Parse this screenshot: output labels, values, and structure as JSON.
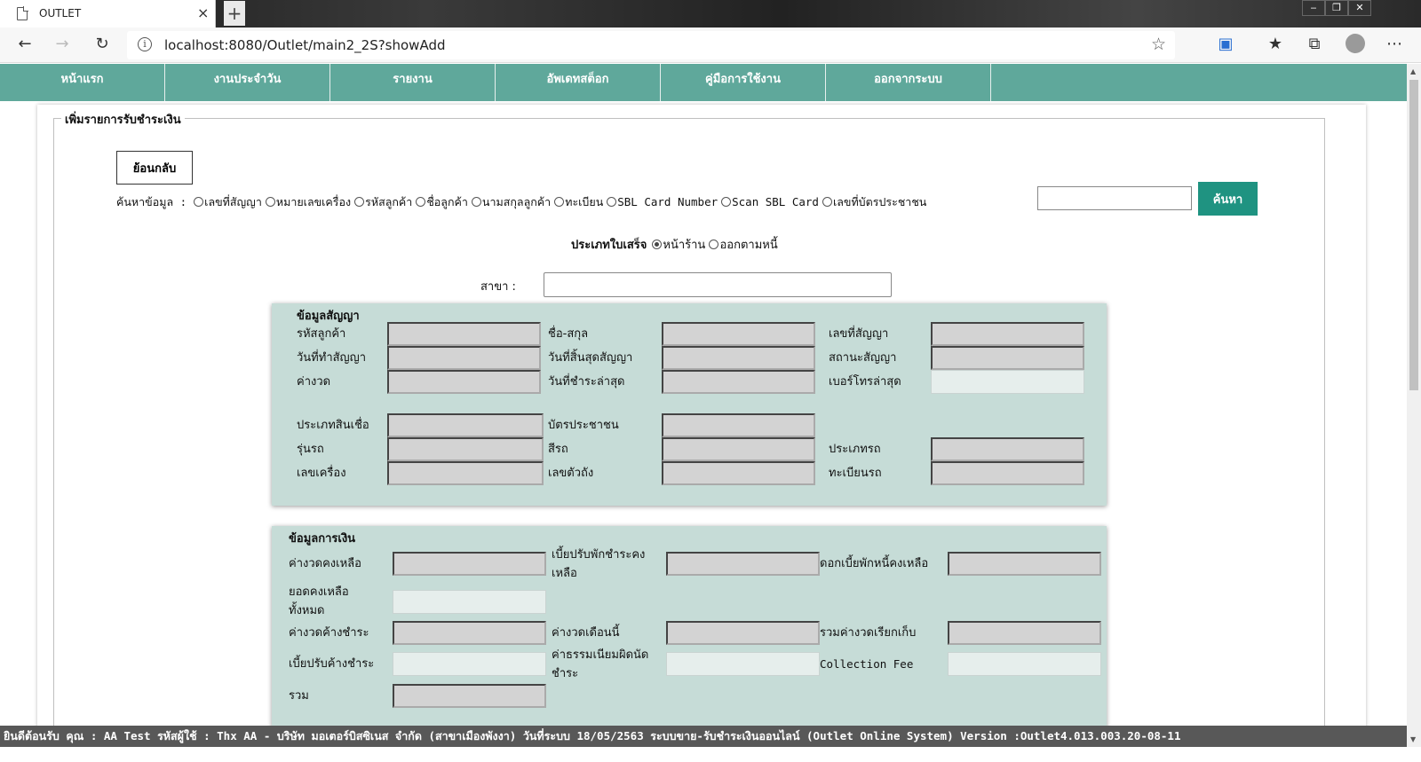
{
  "browser": {
    "tab_title": "OUTLET",
    "tab_close": "×",
    "new_tab": "+",
    "url": "localhost:8080/Outlet/main2_2S?showAdd",
    "info": "i",
    "window_controls": [
      "‒",
      "❐",
      "✕"
    ]
  },
  "icons": [
    "back-icon",
    "forward-icon",
    "reload-icon",
    "info-icon",
    "favorite-star-icon",
    "reading-icon",
    "favorites-icon",
    "collections-icon",
    "profile-icon",
    "more-icon"
  ],
  "nav": {
    "items": [
      "หน้าแรก",
      "งานประจำวัน",
      "รายงาน",
      "อัพเดทสต็อก",
      "คู่มือการใช้งาน",
      "ออกจากระบบ"
    ]
  },
  "form": {
    "legend": "เพิ่มรายการรับชำระเงิน",
    "back_label": "ย้อนกลับ",
    "search_label": "ค้นหาข้อมูล  :",
    "search_options": [
      "เลขที่สัญญา",
      "หมายเลขเครื่อง",
      "รหัสลูกค้า",
      "ชื่อลูกค้า",
      "นามสกุลลูกค้า",
      "ทะเบียน",
      "SBL Card Number",
      "Scan SBL Card",
      "เลขที่บัตรประชาชน"
    ],
    "search_button": "ค้นหา",
    "search_value": "",
    "receipt_type_label": "ประเภทใบเสร็จ",
    "receipt_options": [
      "หน้าร้าน",
      "ออกตามหนี้"
    ],
    "receipt_selected": "หน้าร้าน",
    "branch_label": "สาขา  :",
    "branch_value": ""
  },
  "contract": {
    "title": "ข้อมูลสัญญา",
    "labels": {
      "customer_code": "รหัสลูกค้า",
      "full_name": "ชื่อ-สกุล",
      "contract_no": "เลขที่สัญญา",
      "contract_date": "วันที่ทำสัญญา",
      "contract_end": "วันที่สิ้นสุดสัญญา",
      "contract_status": "สถานะสัญญา",
      "installment": "ค่างวด",
      "last_paid": "วันที่ชำระล่าสุด",
      "last_phone": "เบอร์โทรล่าสุด",
      "credit_type": "ประเภทสินเชื่อ",
      "id_card": "บัตรประชาชน",
      "model": "รุ่นรถ",
      "color": "สีรถ",
      "vehicle_type": "ประเภทรถ",
      "engine_no": "เลขเครื่อง",
      "chassis_no": "เลขตัวถัง",
      "plate_no": "ทะเบียนรถ"
    }
  },
  "finance": {
    "title": "ข้อมูลการเงิน",
    "labels": {
      "remaining_installment": "ค่างวดคงเหลือ",
      "remaining_penalty": "เบี้ยปรับพักชำระคงเหลือ",
      "remaining_interest": "ดอกเบี้ยพักหนี้คงเหลือ",
      "total_remaining": "ยอดคงเหลือทั้งหมด",
      "overdue_installment": "ค่างวดค้างชำระ",
      "this_month_installment": "ค่างวดเดือนนี้",
      "total_collect": "รวมค่างวดเรียกเก็บ",
      "overdue_penalty": "เบี้ยปรับค้างชำระ",
      "late_fee": "ค่าธรรมเนียมผิดนัดชำระ",
      "collection_fee": "Collection Fee",
      "total": "รวม"
    }
  },
  "status": {
    "text": "ยินดีต้อนรับ คุณ : AA Test รหัสผู้ใช้ : Thx  AA - บริษัท มอเตอร์บิสซิเนส จำกัด (สาขาเมืองพังงา)   วันที่ระบบ 18/05/2563    ระบบขาย-รับชำระเงินออนไลน์ (Outlet Online System)  Version :Outlet4.013.003.20-08-11"
  }
}
